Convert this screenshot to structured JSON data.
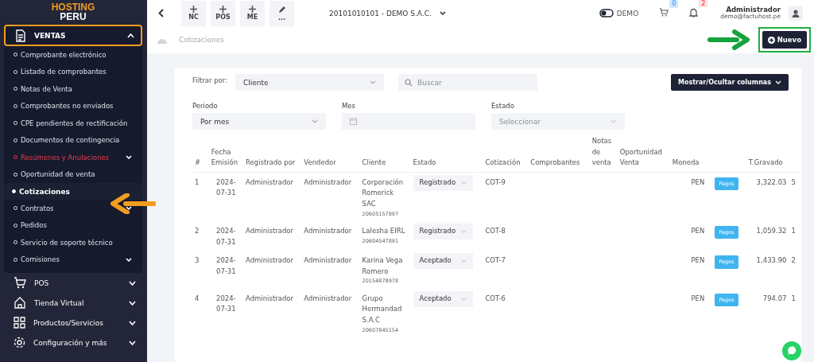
{
  "sidebar": {
    "logo": [
      "HOSTING",
      "PERU"
    ],
    "sections": [
      {
        "label": "VENTAS",
        "kind": "document",
        "expanded": true,
        "children": [
          {
            "label": "Comprobante electrónico",
            "selected": false,
            "highlighted": false,
            "has_submenu": false
          },
          {
            "label": "Listado de comprobantes",
            "selected": false,
            "highlighted": false,
            "has_submenu": false
          },
          {
            "label": "Notas de Venta",
            "selected": false,
            "highlighted": false,
            "has_submenu": false
          },
          {
            "label": "Comprobantes no enviados",
            "selected": false,
            "highlighted": false,
            "has_submenu": false
          },
          {
            "label": "CPE pendientes de rectificación",
            "selected": false,
            "highlighted": false,
            "has_submenu": false
          },
          {
            "label": "Documentos de contingencia",
            "selected": false,
            "highlighted": false,
            "has_submenu": false
          },
          {
            "label": "Resúmenes y Anulaciones",
            "selected": false,
            "highlighted": true,
            "has_submenu": true
          },
          {
            "label": "Oportunidad de venta",
            "selected": false,
            "highlighted": false,
            "has_submenu": false
          },
          {
            "label": "Cotizaciones",
            "selected": true,
            "highlighted": false,
            "has_submenu": false
          },
          {
            "label": "Contratos",
            "selected": false,
            "highlighted": false,
            "has_submenu": true
          },
          {
            "label": "Pedidos",
            "selected": false,
            "highlighted": false,
            "has_submenu": false
          },
          {
            "label": "Servicio de soporte técnico",
            "selected": false,
            "highlighted": false,
            "has_submenu": false
          },
          {
            "label": "Comisiones",
            "selected": false,
            "highlighted": false,
            "has_submenu": true
          }
        ]
      },
      {
        "label": "POS",
        "kind": "cart",
        "expanded": false
      },
      {
        "label": "Tienda Virtual",
        "kind": "home",
        "expanded": false
      },
      {
        "label": "Productos/Servicios",
        "kind": "grid",
        "expanded": false
      },
      {
        "label": "Configuración y más",
        "kind": "gear",
        "expanded": false
      }
    ]
  },
  "topbar": {
    "quick_buttons": [
      {
        "kind": "plus",
        "label": "NC"
      },
      {
        "kind": "plus",
        "label": "POS"
      },
      {
        "kind": "plus",
        "label": "ME"
      },
      {
        "kind": "pencil",
        "label": "..."
      }
    ],
    "company": "20101010101 - DEMO S.A.C.",
    "mode": {
      "label": "DEMO",
      "on": false
    },
    "cart_count": "0",
    "notification_count": "2",
    "user": {
      "name": "Administrador",
      "email": "demo@factuhost.pe"
    }
  },
  "breadcrumb": "Cotizaciones",
  "new_button": "Nuevo",
  "filters": {
    "filter_label": "Filtrar por:",
    "filter_value": "Cliente",
    "search_placeholder": "Buscar",
    "columns_button": "Mostrar/Ocultar columnas",
    "period": {
      "label": "Periodo",
      "value": "Por mes"
    },
    "month": {
      "label": "Mes"
    },
    "status": {
      "label": "Estado",
      "placeholder": "Seleccionar"
    }
  },
  "table": {
    "columns": [
      "#",
      "Fecha Emisión",
      "Registrado por",
      "Vendedor",
      "Cliente",
      "Estado",
      "Cotización",
      "Comprobantes",
      "Notas de venta",
      "Oportunidad Venta",
      "Moneda",
      "",
      "T.Gravado",
      ""
    ],
    "rows": [
      {
        "number": "1",
        "date": "2024-07-31",
        "registered_by": "Administrador",
        "seller": "Administrador",
        "client": "Corporación Romerick SAC",
        "client_id": "20605157897",
        "status": "Registrado",
        "quote": "COT-9",
        "currency": "PEN",
        "payments_button": "Pagos",
        "taxable": "3,322.03",
        "column_14": "5"
      },
      {
        "number": "2",
        "date": "2024-07-31",
        "registered_by": "Administrador",
        "seller": "Administrador",
        "client": "Lalesha EIRL",
        "client_id": "20604547891",
        "status": "Registrado",
        "quote": "COT-8",
        "currency": "PEN",
        "payments_button": "Pagos",
        "taxable": "1,059.32",
        "column_14": "1"
      },
      {
        "number": "3",
        "date": "2024-07-31",
        "registered_by": "Administrador",
        "seller": "Administrador",
        "client": "Karina Vega Romero",
        "client_id": "20154878978",
        "status": "Aceptado",
        "quote": "COT-7",
        "currency": "PEN",
        "payments_button": "Pagos",
        "taxable": "1,433.90",
        "column_14": "2"
      },
      {
        "number": "4",
        "date": "2024-07-31",
        "registered_by": "Administrador",
        "seller": "Administrador",
        "client": "Grupo Hermandad S.A.C",
        "client_id": "20607845154",
        "status": "Aceptado",
        "quote": "COT-6",
        "currency": "PEN",
        "payments_button": "Pagos",
        "taxable": "794.07",
        "column_14": "1"
      }
    ]
  }
}
